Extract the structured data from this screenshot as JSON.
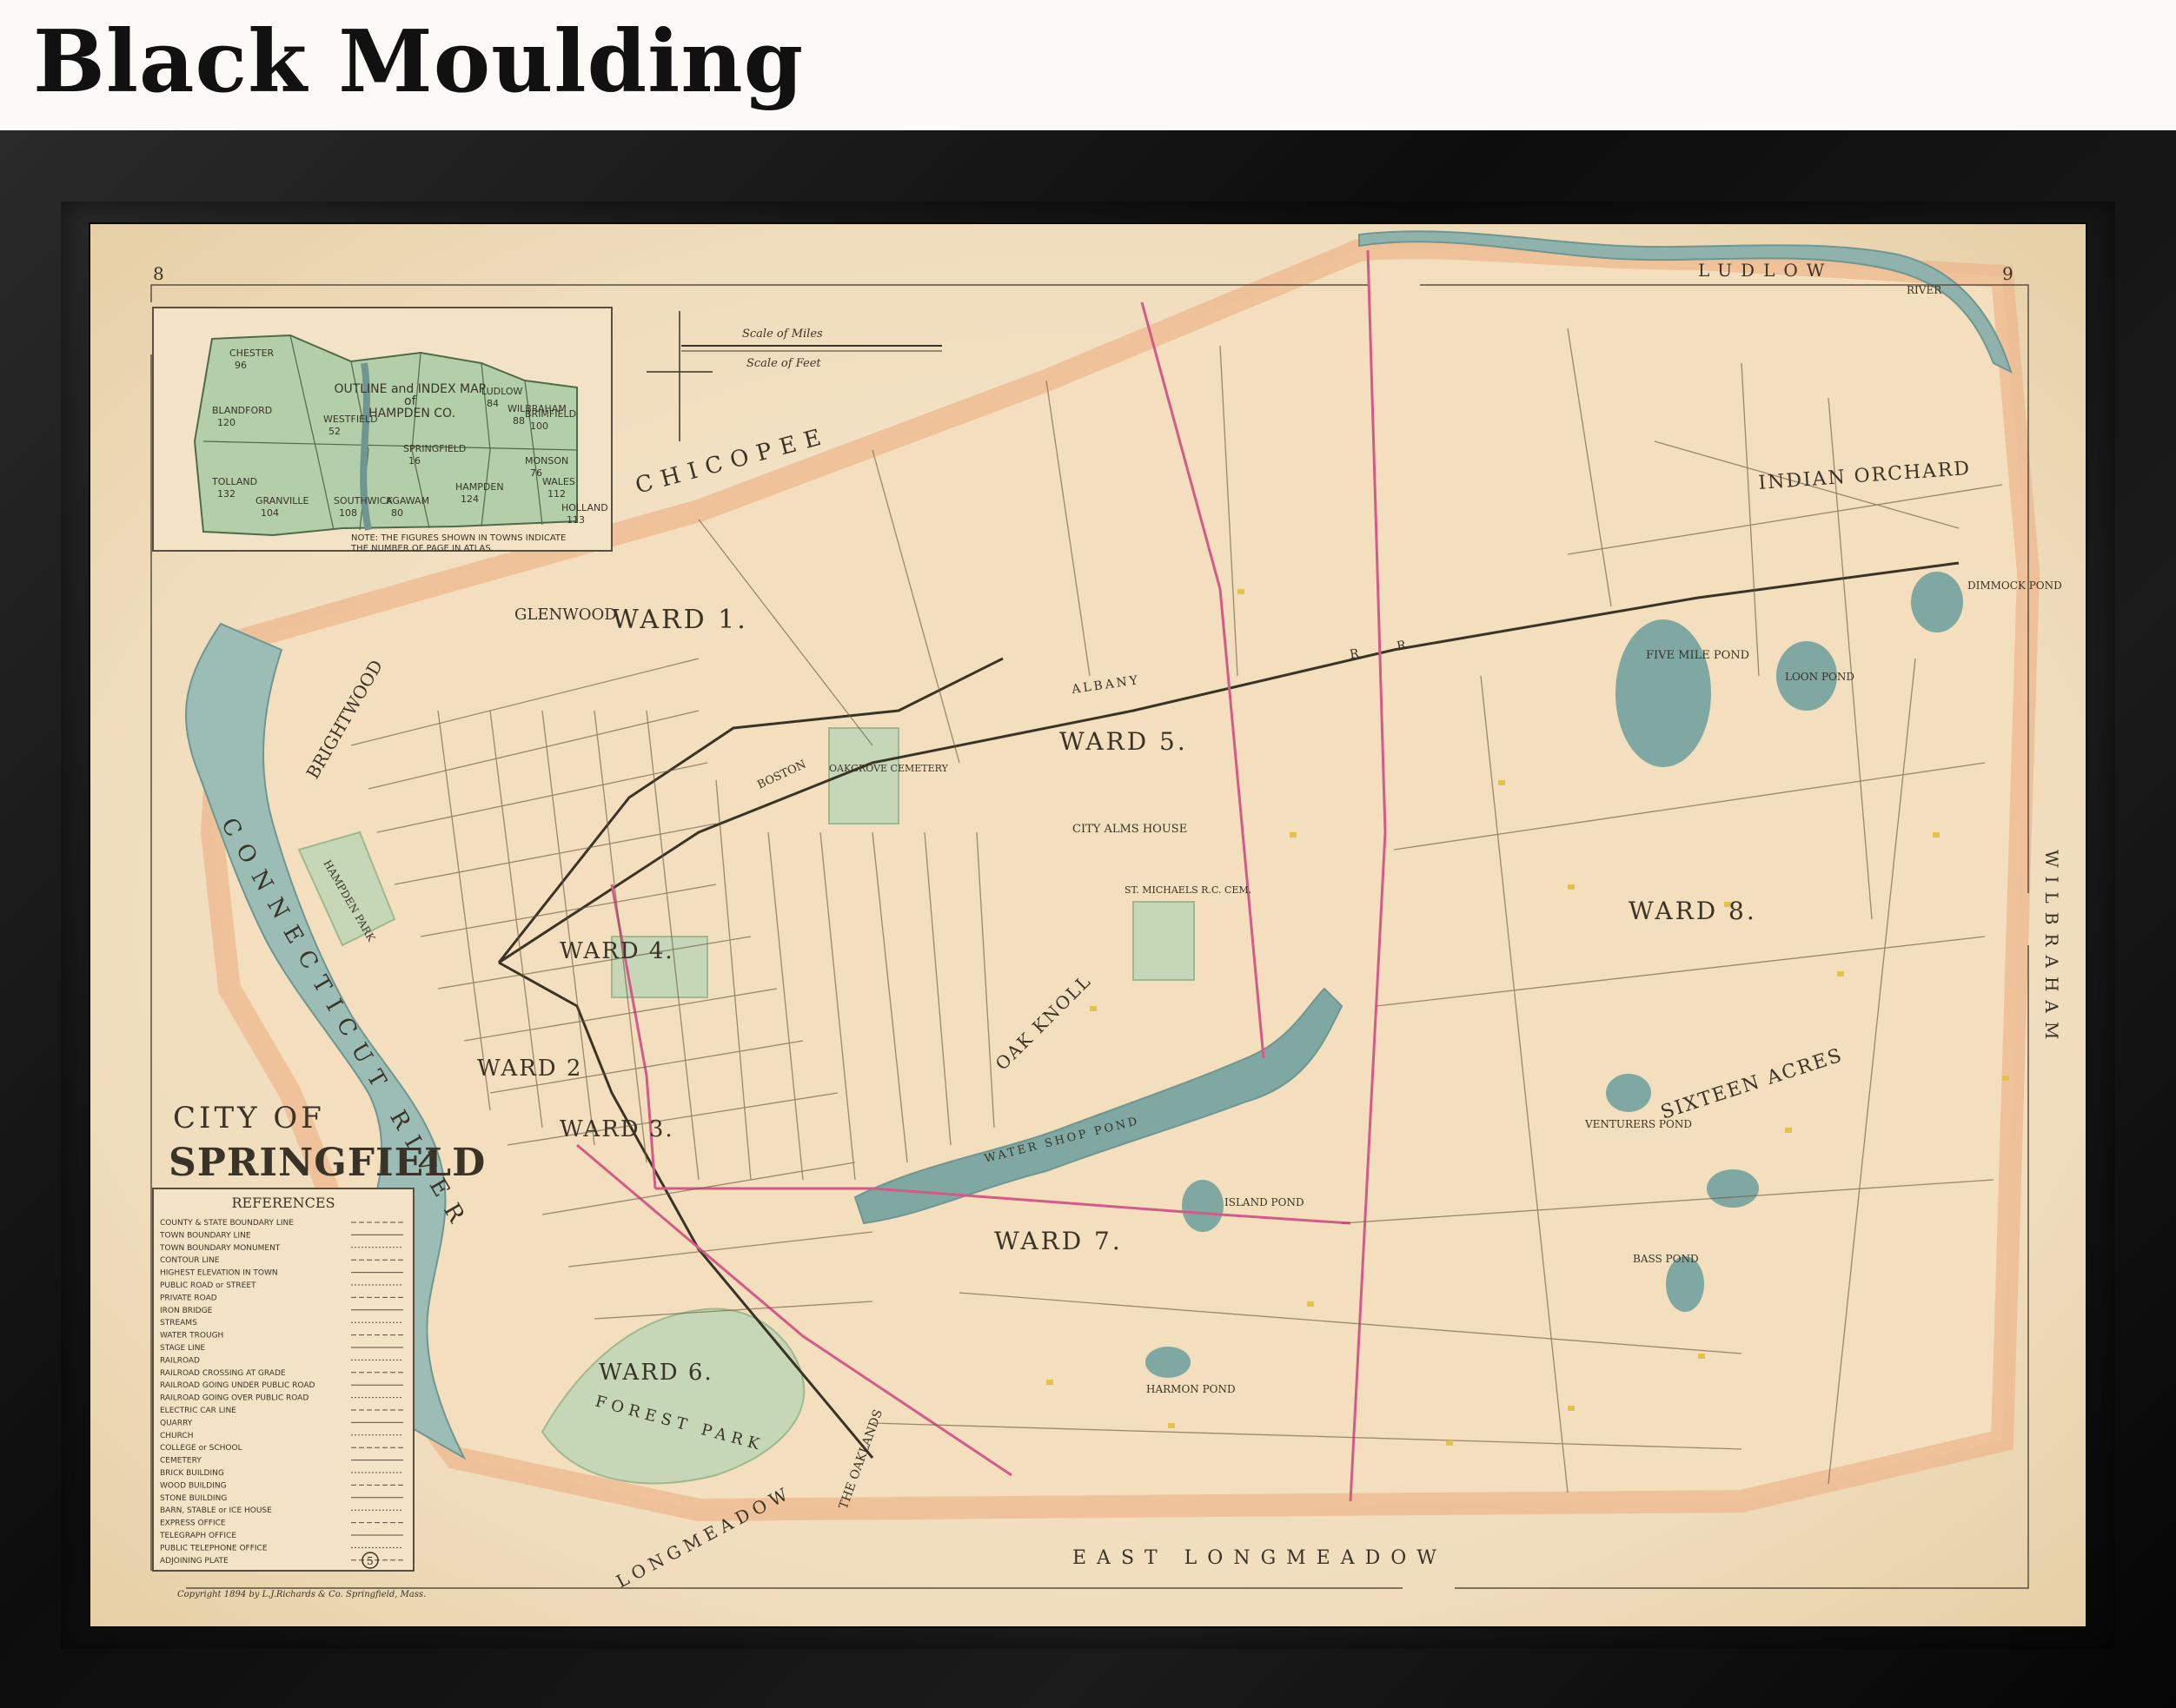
{
  "title": "Black Moulding",
  "map": {
    "page_left": "8",
    "page_right": "9",
    "city_label_line1": "CITY OF",
    "city_label_line2": "SPRINGFIELD",
    "wards": [
      "WARD 1.",
      "WARD 2",
      "WARD 3.",
      "WARD 4.",
      "WARD 5.",
      "WARD 6.",
      "WARD 7.",
      "WARD 8."
    ],
    "places": {
      "indian_orchard": "INDIAN ORCHARD",
      "sixteen_acres": "SIXTEEN ACRES",
      "glenwood": "GLENWOOD",
      "brightwood": "BRIGHTWOOD",
      "oak_knoll": "OAK KNOLL",
      "forest_park": "FOREST PARK",
      "the_oaklands": "THE OAKLANDS",
      "hampden_park": "HAMPDEN PARK",
      "oakgrove_cemetery": "OAKGROVE CEMETERY",
      "city_alms_house": "CITY ALMS HOUSE",
      "st_michaels_cem": "ST. MICHAELS R.C. CEM."
    },
    "borders": {
      "north": "CHICOPEE",
      "north_east": "LUDLOW",
      "east": "WILBRAHAM",
      "south": "EAST LONGMEADOW",
      "south_west": "LONGMEADOW",
      "river": "CONNECTICUT RIVER"
    },
    "water": {
      "five_mile_pond": "FIVE MILE POND",
      "loon_pond": "LOON POND",
      "dimmock_pond": "DIMMOCK POND",
      "watershops_pond": "WATER SHOP POND",
      "island_pond": "ISLAND POND",
      "venturers_pond": "VENTURERS POND",
      "bass_pond": "BASS POND",
      "harmon_pond": "HARMON POND",
      "chicopee_river": "RIVER"
    },
    "railroads": {
      "boston_albany_1": "BOSTON",
      "boston_albany_2": "ALBANY",
      "rr": "R R"
    },
    "inset": {
      "title_line1": "OUTLINE and INDEX MAP",
      "title_line2": "of",
      "title_line3": "HAMPDEN CO.",
      "note_line1": "NOTE: THE FIGURES SHOWN IN TOWNS INDICATE",
      "note_line2": "THE NUMBER OF PAGE IN ATLAS.",
      "towns": [
        {
          "name": "CHESTER",
          "page": "96"
        },
        {
          "name": "BLANDFORD",
          "page": "120"
        },
        {
          "name": "TOLLAND",
          "page": "132"
        },
        {
          "name": "GRANVILLE",
          "page": "104"
        },
        {
          "name": "SOUTHWICK",
          "page": "108"
        },
        {
          "name": "WESTFIELD",
          "page": "52"
        },
        {
          "name": "AGAWAM",
          "page": "80"
        },
        {
          "name": "SPRINGFIELD",
          "page": "16"
        },
        {
          "name": "LUDLOW",
          "page": "84"
        },
        {
          "name": "MONSON",
          "page": "76"
        },
        {
          "name": "HAMPDEN",
          "page": "124"
        },
        {
          "name": "BRIMFIELD",
          "page": "100"
        },
        {
          "name": "WALES",
          "page": "112"
        },
        {
          "name": "HOLLAND",
          "page": "113"
        },
        {
          "name": "WILBRAHAM",
          "page": "88"
        }
      ]
    },
    "scale": {
      "miles": "Scale of Miles",
      "feet": "Scale of Feet"
    },
    "references": {
      "title": "REFERENCES",
      "items": [
        "COUNTY & STATE BOUNDARY LINE",
        "TOWN BOUNDARY LINE",
        "TOWN BOUNDARY MONUMENT",
        "CONTOUR LINE",
        "HIGHEST ELEVATION IN TOWN",
        "PUBLIC ROAD or STREET",
        "PRIVATE ROAD",
        "IRON BRIDGE",
        "STREAMS",
        "WATER TROUGH",
        "STAGE LINE",
        "RAILROAD",
        "RAILROAD CROSSING AT GRADE",
        "RAILROAD GOING UNDER PUBLIC ROAD",
        "RAILROAD GOING OVER PUBLIC ROAD",
        "ELECTRIC CAR LINE",
        "QUARRY",
        "CHURCH",
        "COLLEGE or SCHOOL",
        "CEMETERY",
        "BRICK BUILDING",
        "WOOD BUILDING",
        "STONE BUILDING",
        "BARN, STABLE or ICE HOUSE",
        "EXPRESS OFFICE",
        "TELEGRAPH OFFICE",
        "PUBLIC TELEPHONE OFFICE",
        "ADJOINING PLATE"
      ],
      "plate_number": "5"
    },
    "copyright": "Copyright 1894 by L.J.Richards & Co. Springfield, Mass."
  },
  "colors": {
    "frame": "#111111",
    "paper": "#f2e2c4",
    "water": "#8fb4b0",
    "park": "#b9d1b0",
    "boundary_wash": "#efb98a",
    "ward_line": "#d45a8a"
  }
}
